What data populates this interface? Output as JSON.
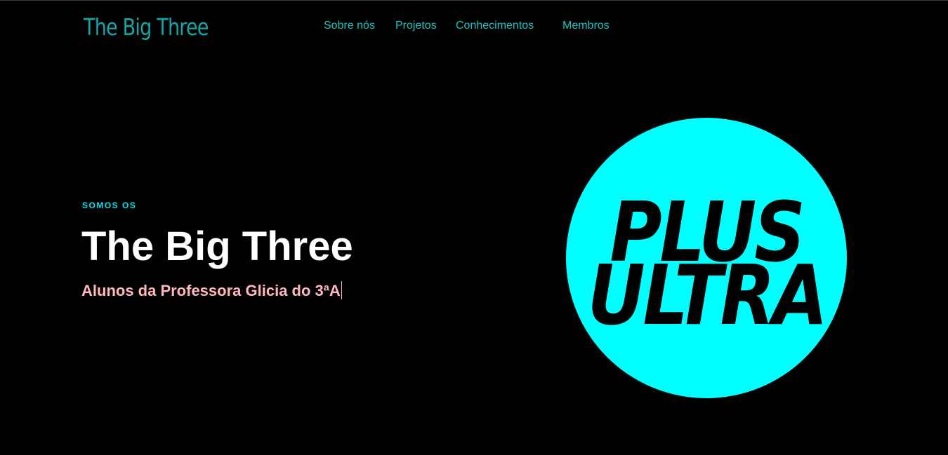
{
  "header": {
    "brand": "The Big Three",
    "nav": [
      {
        "label": "Sobre nós"
      },
      {
        "label": "Projetos"
      },
      {
        "label": "Conhecimentos"
      },
      {
        "label": "Membros"
      }
    ]
  },
  "hero": {
    "eyebrow": "SOMOS OS",
    "title": "The Big Three",
    "subtitle": "Alunos da Professora Glicia do 3ªA"
  },
  "logo": {
    "line1": "PLUS",
    "line2": "ULTRA"
  },
  "colors": {
    "background": "#000000",
    "brand": "#14a5a7",
    "nav": "#1ec3c3",
    "eyebrow": "#00e5ee",
    "subtitle": "#ffb6c1",
    "logo_circle": "#00ffff"
  }
}
